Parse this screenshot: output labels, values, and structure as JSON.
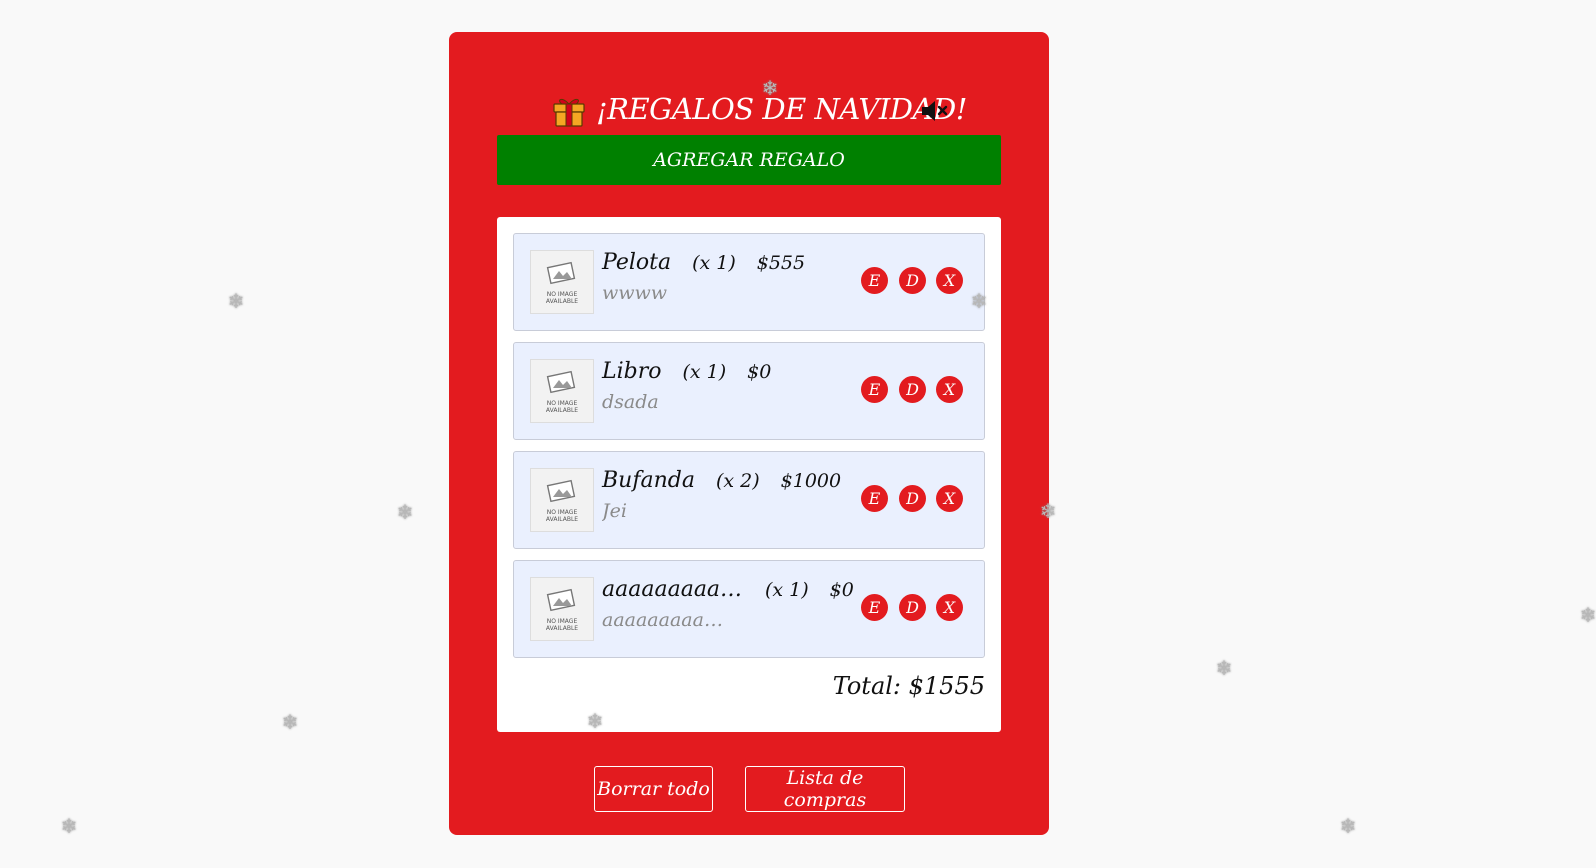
{
  "app": {
    "title": "¡REGALOS DE NAVIDAD!",
    "gift_icon": "gift-icon",
    "mute_icon": "speaker-muted-icon",
    "brand_color": "#e31b1f",
    "accent_color": "#008000"
  },
  "add_button": {
    "label": "AGREGAR REGALO"
  },
  "gifts": [
    {
      "name": "Pelota",
      "qty": "(x 1)",
      "price": "$555",
      "desc": "wwww",
      "image_text": "NO IMAGE\nAVAILABLE",
      "edit": "E",
      "duplicate": "D",
      "delete": "X"
    },
    {
      "name": "Libro",
      "qty": "(x 1)",
      "price": "$0",
      "desc": "dsada",
      "image_text": "NO IMAGE\nAVAILABLE",
      "edit": "E",
      "duplicate": "D",
      "delete": "X"
    },
    {
      "name": "Bufanda",
      "qty": "(x 2)",
      "price": "$1000",
      "desc": "Jei",
      "image_text": "NO IMAGE\nAVAILABLE",
      "edit": "E",
      "duplicate": "D",
      "delete": "X"
    },
    {
      "name": "aaaaaaaaaaa...",
      "qty": "(x 1)",
      "price": "$0",
      "desc": "aaaaaaaaaaaaa...",
      "image_text": "NO IMAGE\nAVAILABLE",
      "edit": "E",
      "duplicate": "D",
      "delete": "X"
    }
  ],
  "total": "Total: $1555",
  "footer": {
    "clear_label": "Borrar todo",
    "list_label": "Lista de compras"
  },
  "snowflake_glyph": "❄"
}
